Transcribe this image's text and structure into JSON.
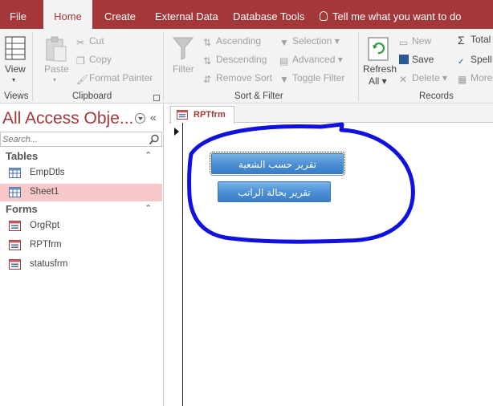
{
  "tabs": {
    "file": "File",
    "home": "Home",
    "create": "Create",
    "external": "External Data",
    "dbtools": "Database Tools",
    "tellme": "Tell me what you want to do"
  },
  "ribbon": {
    "views": {
      "view": "View",
      "group": "Views"
    },
    "clipboard": {
      "paste": "Paste",
      "cut": "Cut",
      "copy": "Copy",
      "format_painter": "Format Painter",
      "group": "Clipboard"
    },
    "sortfilter": {
      "filter": "Filter",
      "ascending": "Ascending",
      "descending": "Descending",
      "remove_sort": "Remove Sort",
      "selection": "Selection",
      "advanced": "Advanced",
      "toggle_filter": "Toggle Filter",
      "group": "Sort & Filter"
    },
    "records": {
      "refresh": "Refresh",
      "refresh_all": "All",
      "new": "New",
      "save": "Save",
      "delete": "Delete",
      "totals": "Total",
      "spelling": "Spell",
      "more": "More",
      "group": "Records"
    }
  },
  "nav": {
    "title": "All Access Obje...",
    "search_placeholder": "Search...",
    "tables_label": "Tables",
    "tables": [
      "EmpDtls",
      "Sheet1"
    ],
    "forms_label": "Forms",
    "forms": [
      "OrgRpt",
      "RPTfrm",
      "statusfrm"
    ]
  },
  "document": {
    "tab": "RPTfrm",
    "button1": "تقرير حسب الشعبة",
    "button2": "تقرير بحالة الراتب"
  },
  "colors": {
    "accent": "#a4373a",
    "selected": "#f8c8c8",
    "annotation": "#1010e0"
  }
}
